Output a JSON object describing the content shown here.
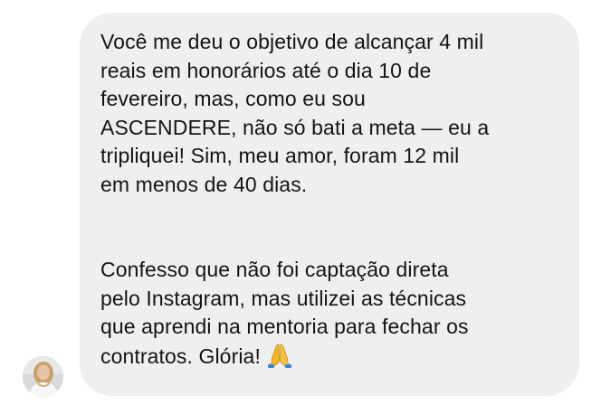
{
  "chat": {
    "message": {
      "paragraph_1": "Você me deu o objetivo de alcançar 4 mil\nreais em honorários até o dia 10 de\nfevereiro, mas, como eu sou\nASCENDERE, não só bati a meta — eu a\ntripliquei! Sim, meu amor, foram 12 mil\nem menos de 40 dias.",
      "paragraph_2": "Confesso que não foi captação direta\npelo Instagram, mas utilizei as técnicas\nque aprendi na mentoria para fechar os\ncontratos. Glória!",
      "emoji_icon": "praying-hands-icon"
    },
    "sender_avatar_icon": "avatar",
    "colors": {
      "bubble": "#efeff0",
      "text": "#141414",
      "emoji": "#f5b52b"
    }
  }
}
